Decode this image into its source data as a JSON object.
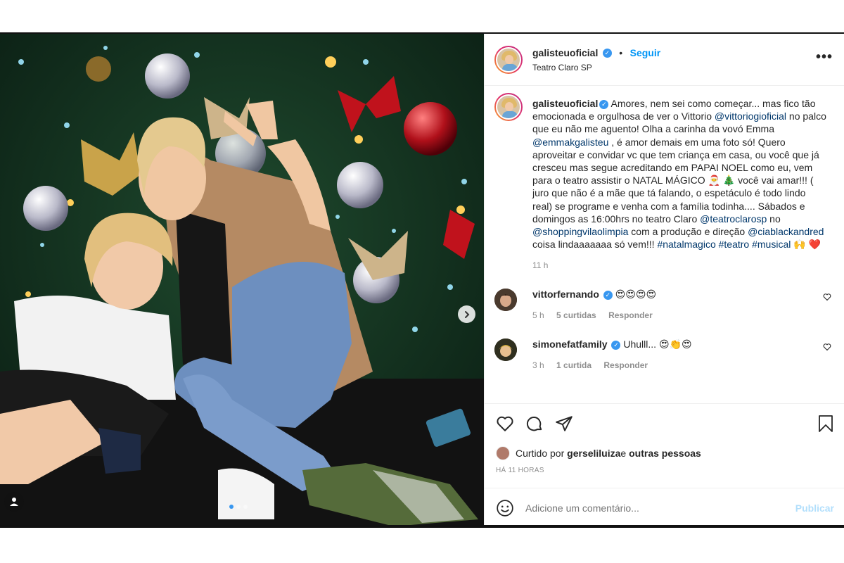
{
  "post": {
    "username": "galisteuoficial",
    "follow_label": "Seguir",
    "separator": "•",
    "location": "Teatro Claro SP",
    "more_label": "•••",
    "caption": {
      "p1": "Amores, nem sei como começar... mas fico tão emocionada e orgulhosa de ver o Vittorio ",
      "m1": "@vittoriogioficial",
      "p2": " no palco que eu não me aguento! Olha a carinha da vovó Emma ",
      "m2": "@emmakgalisteu",
      "p3": " , é amor demais em uma foto só! Quero aproveitar e convidar vc que tem criança em casa, ou você que já cresceu mas segue acreditando em PAPAI NOEL como eu, vem para o teatro assistir o NATAL MÁGICO 🎅 🎄 você vai amar!!! ( juro que não é a mãe que tá falando, o espetáculo é todo lindo real) se programe e venha com a família todinha.... Sábados e domingos as 16:00hrs no teatro Claro ",
      "m3": "@teatroclarosp",
      "p4": " no ",
      "m4": "@shoppingvilaolimpia",
      "p5": " com a produção e direção ",
      "m5": "@ciablackandred",
      "p6": " coisa lindaaaaaaa só vem!!! ",
      "t1": "#natalmagico",
      "t2": "#teatro",
      "t3": "#musical",
      "p7": " 🙌 ❤️"
    },
    "caption_time": "11 h",
    "comments": [
      {
        "user": "vittorfernando",
        "text": "😍😍😍😍",
        "time": "5 h",
        "likes": "5 curtidas",
        "reply": "Responder"
      },
      {
        "user": "simonefatfamily",
        "text": "Uhulll... 😍👏😍",
        "time": "3 h",
        "likes": "1 curtida",
        "reply": "Responder"
      }
    ],
    "liked_by": {
      "prefix": "Curtido por ",
      "user": "gerseliluiza",
      "middle": " e ",
      "others": "outras pessoas"
    },
    "posted_ago": "HÁ 11 HORAS",
    "add_comment_placeholder": "Adicione um comentário...",
    "publish_label": "Publicar",
    "carousel": {
      "total": 3,
      "active": 1
    }
  }
}
